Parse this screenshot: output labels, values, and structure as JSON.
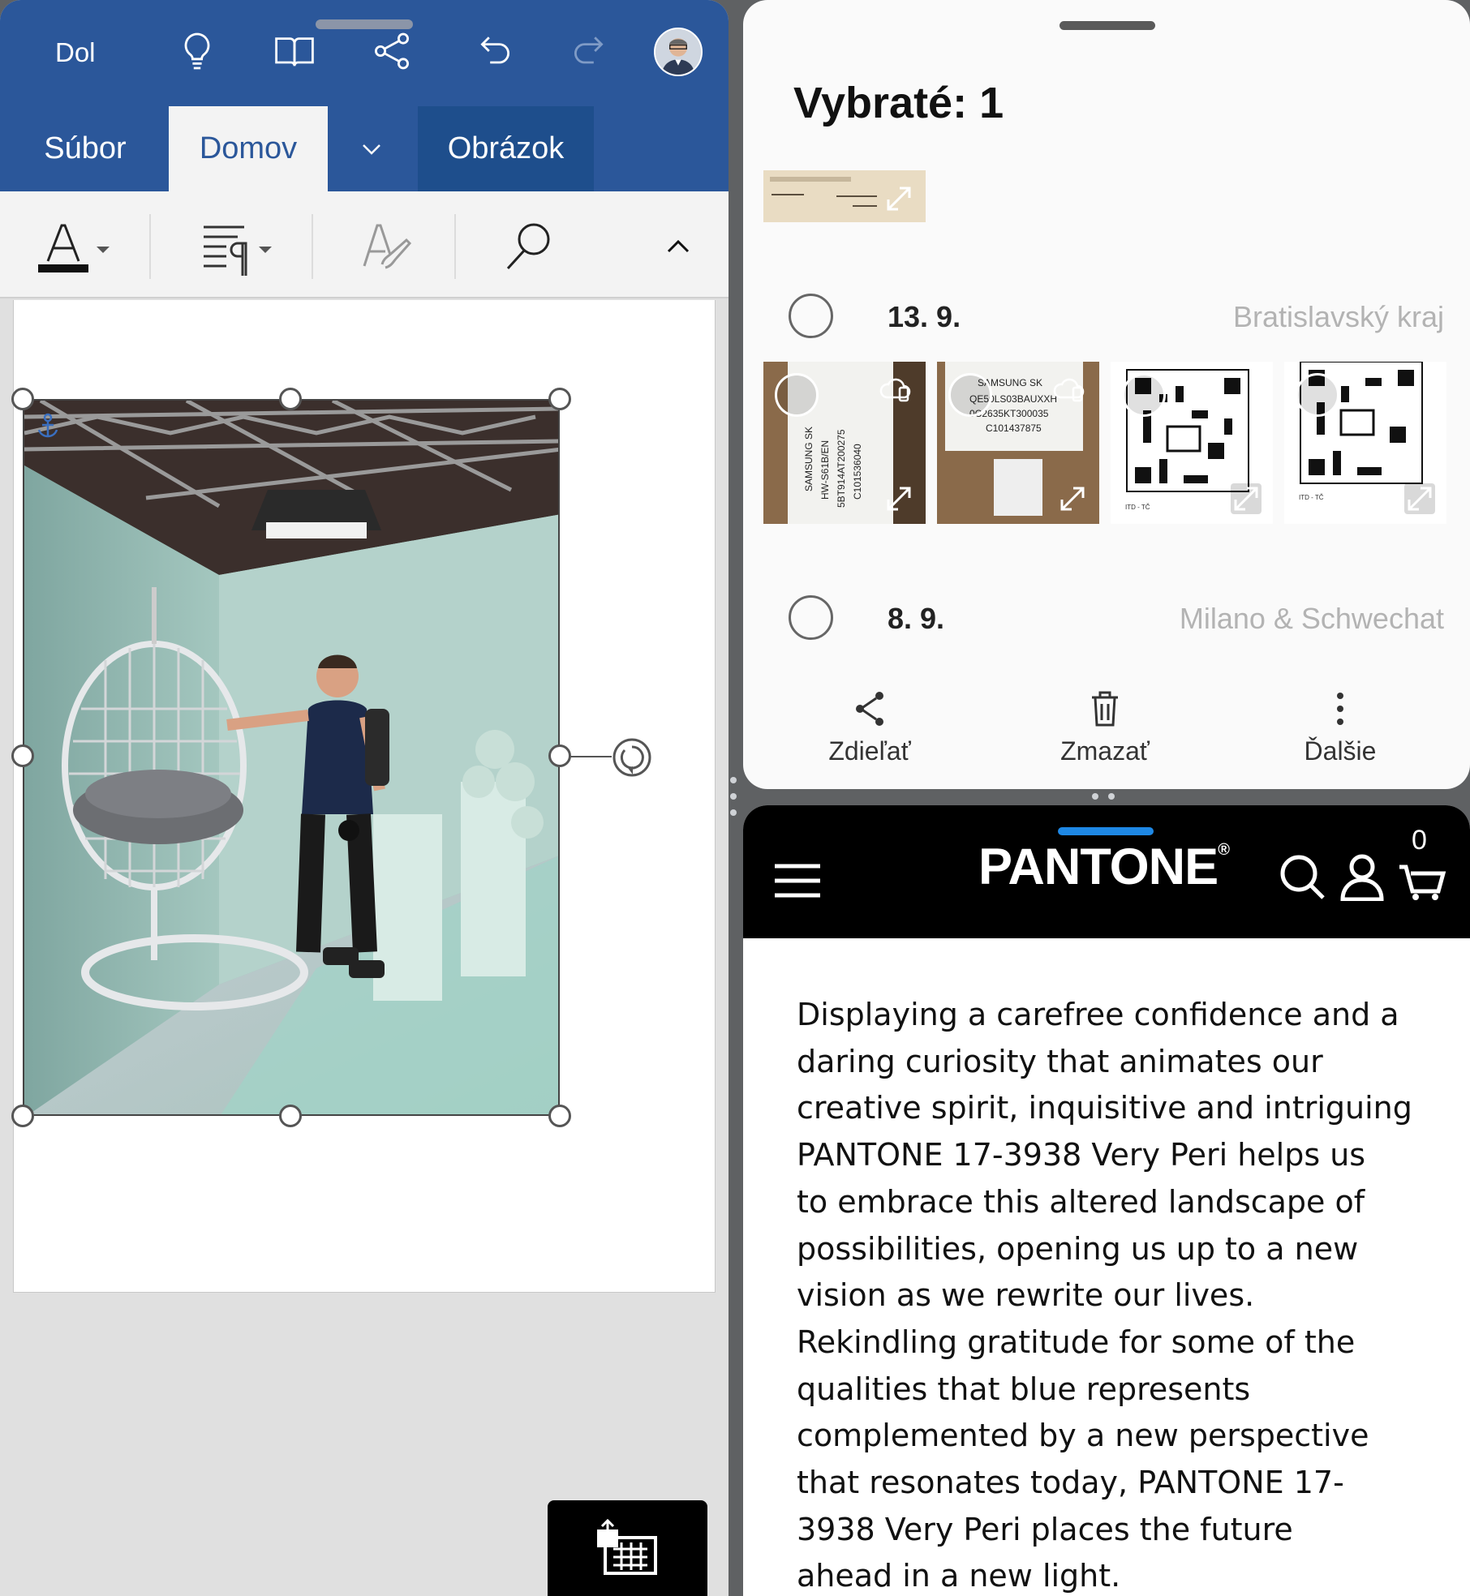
{
  "word": {
    "top_label": "Dol",
    "tabs": {
      "file": "Súbor",
      "home": "Domov",
      "picture": "Obrázok"
    },
    "icons": [
      "lightbulb-icon",
      "read-mode-icon",
      "share-icon",
      "undo-icon",
      "redo-icon"
    ],
    "accent": "#2b579a"
  },
  "gallery": {
    "selected_title": "Vybraté: 1",
    "groups": [
      {
        "date": "13. 9.",
        "location": "Bratislavský kraj"
      },
      {
        "date": "8. 9.",
        "location": "Milano & Schwechat"
      }
    ],
    "thumb_texts": {
      "t1": "SAMSUNG SK  HW-S61B/EN  5BT914AT200275  C101536040",
      "t2": "SAMSUNG SK  QE50LS03BAUXXH  0C2635KT300035  C101437875"
    },
    "actions": {
      "share": "Zdieľať",
      "delete": "Zmazať",
      "more": "Ďalšie"
    }
  },
  "pantone": {
    "logo": "PANTONE",
    "cart_count": "0",
    "article_lines": [
      "Displaying a carefree confidence and a",
      "daring curiosity that animates our",
      "creative spirit, inquisitive and intriguing",
      "PANTONE 17-3938 Very Peri helps us",
      "to embrace this altered landscape of",
      "possibilities, opening us up to a new",
      "vision as we rewrite our lives.",
      "Rekindling gratitude for some of the",
      "qualities that blue represents",
      "complemented by a new perspective",
      "that resonates today, PANTONE 17-",
      "3938 Very Peri places the future",
      "ahead in a new light."
    ]
  }
}
